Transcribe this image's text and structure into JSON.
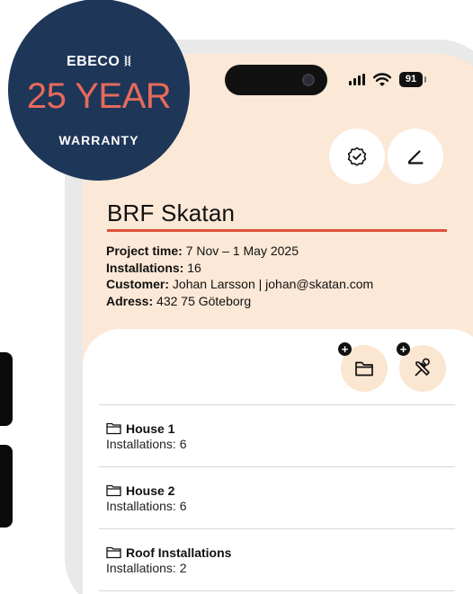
{
  "badge": {
    "brand": "EBECO ⧘⧙",
    "years": "25 YEAR",
    "warranty": "WARRANTY",
    "bg_color": "#1e3658",
    "accent_color": "#e66a5b"
  },
  "status_bar": {
    "battery": "91",
    "icons": [
      "signal-icon",
      "wifi-icon",
      "battery-icon"
    ]
  },
  "header": {
    "actions": [
      "verified-badge-icon",
      "edit-pencil-icon"
    ]
  },
  "project": {
    "title": "BRF Skatan",
    "accent_color": "#e0513c",
    "details": [
      {
        "label": "Project time:",
        "value": " 7 Nov – 1 May 2025"
      },
      {
        "label": "Installations:",
        "value": " 16"
      },
      {
        "label": "Customer:",
        "value": " Johan Larsson | johan@skatan.com"
      },
      {
        "label": "Adress:",
        "value": " 432 75 Göteborg"
      }
    ]
  },
  "panel": {
    "actions": [
      "add-folder-button",
      "add-installation-button"
    ],
    "items": [
      {
        "title": "House 1",
        "subtitle": "Installations: 6"
      },
      {
        "title": "House 2",
        "subtitle": "Installations: 6"
      },
      {
        "title": "Roof Installations",
        "subtitle": "Installations: 2"
      }
    ]
  },
  "colors": {
    "screen_bg": "#fbe8d6",
    "action_bg": "#fbe6d1"
  }
}
